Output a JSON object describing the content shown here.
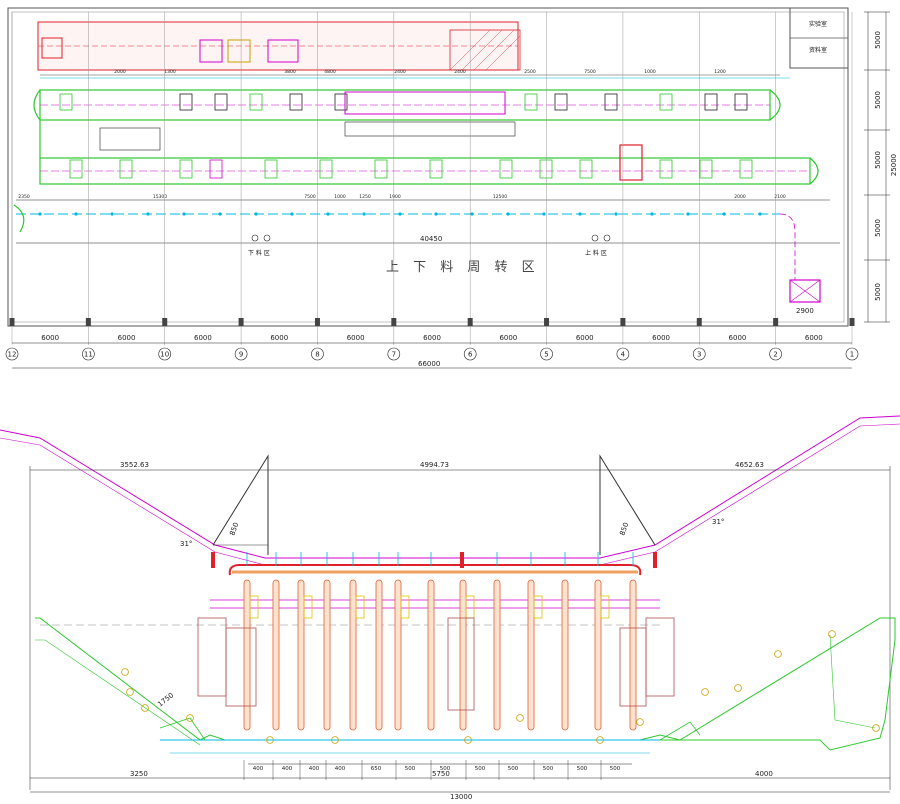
{
  "plan": {
    "zone_title": "上 下 料 周 转 区",
    "unload_label": "下 料 区",
    "load_label": "上 料 区",
    "room_lab": "实验室",
    "room_material": "资料室",
    "right_dims": [
      "5000",
      "5000",
      "25000",
      "5000",
      "5000",
      "5000"
    ],
    "bay_dim": "6000",
    "total_width": "66000",
    "grid_numbers": [
      "12",
      "11",
      "10",
      "9",
      "8",
      "7",
      "6",
      "5",
      "4",
      "3",
      "2",
      "1"
    ],
    "top_dims": [
      "2000",
      "1300",
      "3800",
      "4800",
      "2400",
      "2400",
      "2500",
      "7500",
      "1000",
      "1200"
    ],
    "row_dims": [
      "2350",
      "15300",
      "7500",
      "1000",
      "1250",
      "1900",
      "12500",
      "2000",
      "2100"
    ],
    "mid_dim": "40450",
    "bottom_small": "2900"
  },
  "section": {
    "top_dims": [
      "3552.63",
      "4994.73",
      "4652.63"
    ],
    "angle_left": "31°",
    "angle_right": "31°",
    "bottom_dims": [
      "400",
      "400",
      "400",
      "400",
      "650",
      "500",
      "500",
      "500",
      "500",
      "500",
      "500",
      "500"
    ],
    "dim_3250": "3250",
    "dim_5750": "5750",
    "dim_4000": "4000",
    "total": "13000",
    "small_left": "850",
    "small_right": "850",
    "slope_dim": "1750"
  }
}
